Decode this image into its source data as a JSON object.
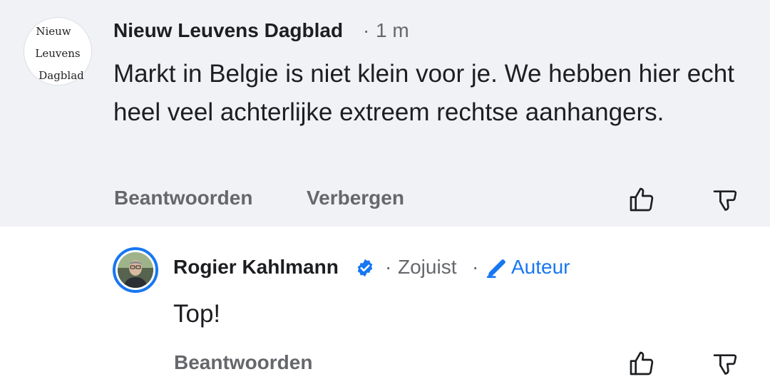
{
  "parent_comment": {
    "avatar_lines": [
      "Nieuw",
      "Leuvens",
      "Dagblad"
    ],
    "author": "Nieuw Leuvens Dagblad",
    "separator": "·",
    "time": "1 m",
    "text": "Markt in Belgie is niet klein voor je. We hebben hier echt heel veel achterlijke extreem rechtse aanhangers.",
    "actions": {
      "reply": "Beantwoorden",
      "hide": "Verbergen"
    },
    "icons": [
      "thumbs-up-icon",
      "thumbs-down-icon"
    ]
  },
  "reply_comment": {
    "author": "Rogier Kahlmann",
    "verified": true,
    "separator1": "·",
    "time": "Zojuist",
    "separator2": "·",
    "author_badge": "Auteur",
    "text": "Top!",
    "actions": {
      "reply": "Beantwoorden"
    },
    "icons": [
      "thumbs-up-icon",
      "thumbs-down-icon"
    ]
  },
  "colors": {
    "parent_background": "#f0f2f5",
    "accent": "#1877f2",
    "secondary_text": "#65676b",
    "primary_text": "#1c1e21"
  }
}
